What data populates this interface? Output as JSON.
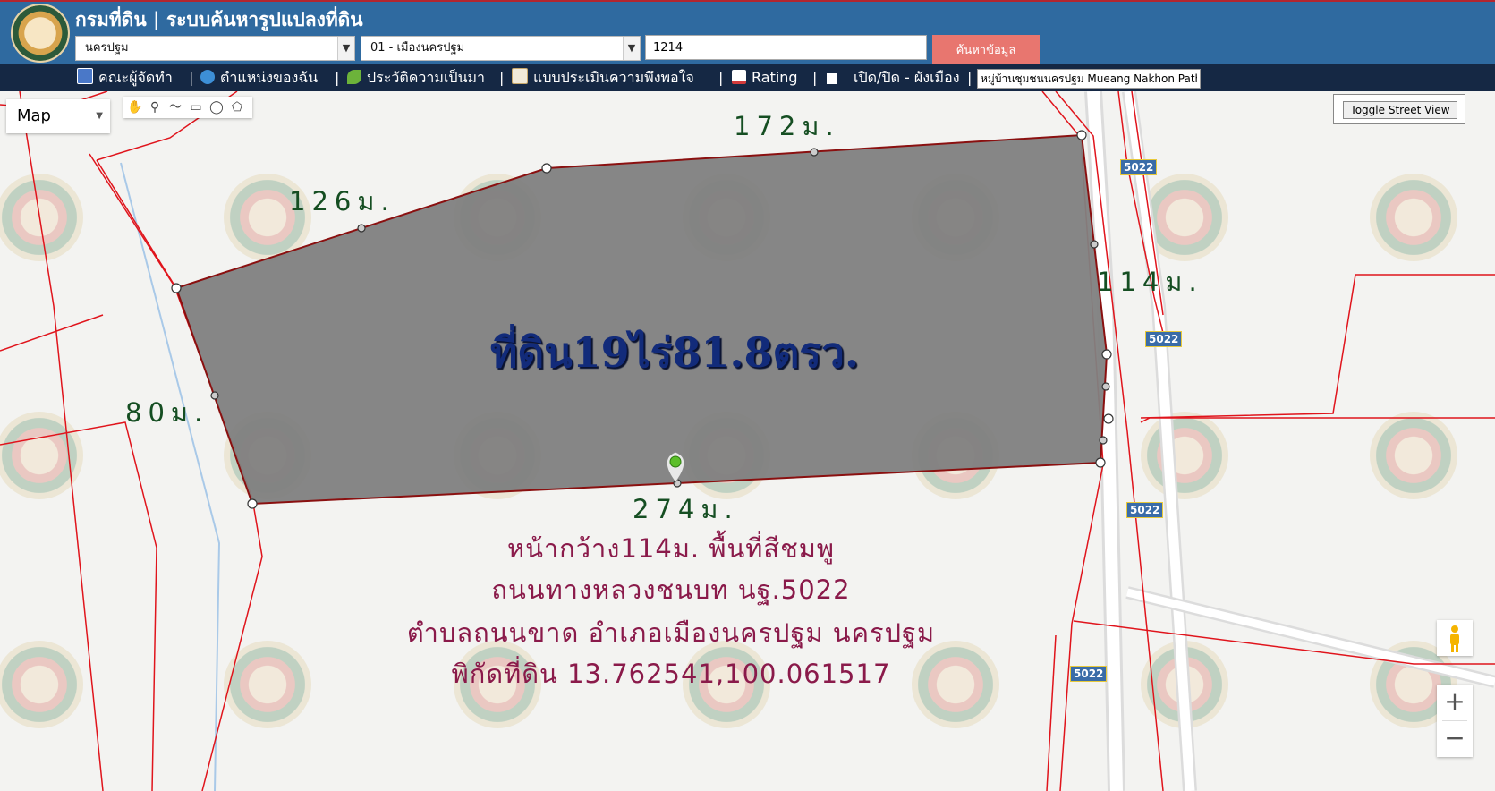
{
  "header": {
    "title": "กรมที่ดิน | ระบบค้นหารูปแปลงที่ดิน",
    "province_select": "นครปฐม",
    "district_select": "01 - เมืองนครปฐม",
    "parcel_number_value": "1214",
    "search_label": "ค้นหาข้อมูล"
  },
  "nav": {
    "items": [
      {
        "label": "คณะผู้จัดทำ",
        "icon": "gift-icon"
      },
      {
        "label": "ตำแหน่งของฉัน",
        "icon": "globe-icon"
      },
      {
        "label": "ประวัติความเป็นมา",
        "icon": "sprout-icon"
      },
      {
        "label": "แบบประเมินความพึงพอใจ",
        "icon": "memo-icon"
      },
      {
        "label": "Rating",
        "icon": "chart-icon"
      },
      {
        "label": "เปิด/ปิด - ผังเมือง",
        "icon": "square-icon"
      }
    ],
    "separator": "|",
    "village_value": "หมู่บ้านชุมชนนครปฐม Mueang Nakhon Pathom"
  },
  "map": {
    "type_label": "Map",
    "street_view_label": "Toggle Street View",
    "zoom_in": "+",
    "zoom_out": "−",
    "area_label": "ที่ดิน19ไร่81.8ตรว.",
    "dimensions": {
      "top": "172ม.",
      "top_left": "126ม.",
      "right": "114ม.",
      "left": "80ม.",
      "bottom": "274ม."
    },
    "caption_lines": [
      "หน้ากว้าง114ม. พื้นที่สีชมพู",
      "ถนนทางหลวงชนบท นฐ.5022",
      "ตำบลถนนขาด อำเภอเมืองนครปฐม นครปฐม",
      "พิกัดที่ดิน 13.762541,100.061517"
    ],
    "road_badges": [
      "5022",
      "5022",
      "5022",
      "5022"
    ],
    "colors": {
      "parcel_fill": "#7f7f7f",
      "boundary": "#e0141c",
      "header": "#2f6aa0",
      "nav": "#152844",
      "search_button": "#e8766f"
    }
  }
}
